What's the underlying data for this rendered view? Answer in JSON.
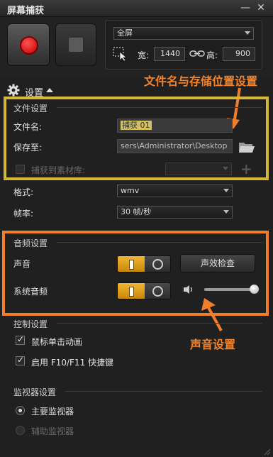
{
  "window": {
    "title": "屏幕捕获"
  },
  "capture": {
    "region_select": "全屏",
    "width_label": "宽:",
    "width_value": "1440",
    "height_label": "高:",
    "height_value": "900"
  },
  "settings": {
    "header_label": "设置",
    "file": {
      "section_title": "文件设置",
      "filename_label": "文件名:",
      "filename_value": "捕获 01",
      "saveto_label": "保存至:",
      "saveto_value": "sers\\Administrator\\Desktop",
      "library_label": "捕获到素材库:"
    },
    "format_label": "格式:",
    "format_value": "wmv",
    "framerate_label": "帧率:",
    "framerate_value": "30 帧/秒",
    "audio": {
      "section_title": "音频设置",
      "sound_label": "声音",
      "sound_check_button": "声效检查",
      "system_audio_label": "系统音频",
      "volume_level": 0.95
    },
    "control": {
      "section_title": "控制设置",
      "mouse_anim_label": "鼠标单击动画",
      "mouse_anim_checked": true,
      "hotkey_label": "启用 F10/F11 快捷键",
      "hotkey_checked": true
    },
    "monitor": {
      "section_title": "监视器设置",
      "primary_label": "主要监视器",
      "secondary_label": "辅助监视器"
    }
  },
  "annotations": {
    "file_note": "文件名与存储位置设置",
    "audio_note": "声音设置",
    "file_color": "#d4b63a",
    "audio_color": "#f07e2c"
  }
}
